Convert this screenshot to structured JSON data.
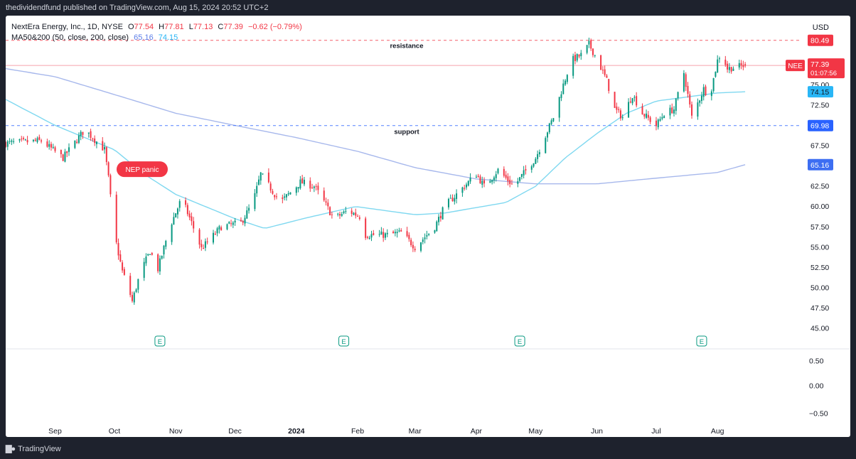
{
  "header": {
    "publisher_line": "thedividendfund published on TradingView.com, Aug 15, 2024 20:52 UTC+2"
  },
  "legend": {
    "symbol_line": "NextEra Energy, Inc., 1D, NYSE",
    "ohlc": {
      "o_label": "O",
      "o": "77.54",
      "h_label": "H",
      "h": "77.81",
      "l_label": "L",
      "l": "77.13",
      "c_label": "C",
      "c": "77.39",
      "change": "−0.62 (−0.79%)"
    },
    "ma_line": "MA50&200 (50, close, 200, close)",
    "ma200_value": "65.16",
    "ma50_value": "74.15"
  },
  "currency": "USD",
  "footer": {
    "brand": "TradingView",
    "logo_icon": "tradingview-logo-icon"
  },
  "colors": {
    "up": "#089981",
    "down": "#f23645",
    "ma50": "#7fd8f0",
    "ma200": "#a7b8ec",
    "support": "#2962ff",
    "resistance": "#f23645"
  },
  "chart_data": {
    "type": "candlestick",
    "symbol": "NEE",
    "price_axis": {
      "min": 43.5,
      "max": 82.8,
      "ticks": [
        "45.00",
        "47.50",
        "50.00",
        "52.50",
        "55.00",
        "57.50",
        "60.00",
        "62.50",
        "65.00",
        "67.50",
        "72.50",
        "75.00"
      ]
    },
    "oscillator_axis": {
      "ticks": [
        "0.50",
        "0.00",
        "−0.50"
      ]
    },
    "time_labels": [
      {
        "label": "Sep",
        "date": "2023-09-01"
      },
      {
        "label": "Oct",
        "date": "2023-10-01"
      },
      {
        "label": "Nov",
        "date": "2023-11-01"
      },
      {
        "label": "Dec",
        "date": "2023-12-01"
      },
      {
        "label": "2024",
        "date": "2024-01-01"
      },
      {
        "label": "Feb",
        "date": "2024-02-01"
      },
      {
        "label": "Mar",
        "date": "2024-03-01"
      },
      {
        "label": "Apr",
        "date": "2024-04-01"
      },
      {
        "label": "May",
        "date": "2024-05-01"
      },
      {
        "label": "Jun",
        "date": "2024-06-01"
      },
      {
        "label": "Jul",
        "date": "2024-07-01"
      },
      {
        "label": "Aug",
        "date": "2024-08-01"
      }
    ],
    "x_range": [
      "2023-08-07",
      "2024-09-12"
    ],
    "last_date": "2024-08-15",
    "price_keyframes": [
      [
        "2023-08-07",
        67.8
      ],
      [
        "2023-08-25",
        68.1
      ],
      [
        "2023-09-05",
        66.0
      ],
      [
        "2023-09-16",
        69.5
      ],
      [
        "2023-09-26",
        67.0
      ],
      [
        "2023-09-28",
        63.5
      ],
      [
        "2023-10-01",
        56.5
      ],
      [
        "2023-10-05",
        52.0
      ],
      [
        "2023-10-08",
        50.0
      ],
      [
        "2023-10-10",
        48.3
      ],
      [
        "2023-10-14",
        51.8
      ],
      [
        "2023-10-19",
        54.5
      ],
      [
        "2023-10-23",
        52.3
      ],
      [
        "2023-10-29",
        57.5
      ],
      [
        "2023-11-04",
        61.0
      ],
      [
        "2023-11-09",
        58.0
      ],
      [
        "2023-11-14",
        54.8
      ],
      [
        "2023-11-24",
        57.5
      ],
      [
        "2023-12-04",
        58.0
      ],
      [
        "2023-12-10",
        60.5
      ],
      [
        "2023-12-14",
        64.0
      ],
      [
        "2023-12-24",
        60.5
      ],
      [
        "2024-01-03",
        63.0
      ],
      [
        "2024-01-10",
        62.5
      ],
      [
        "2024-01-14",
        61.0
      ],
      [
        "2024-01-20",
        58.5
      ],
      [
        "2024-01-27",
        59.5
      ],
      [
        "2024-02-02",
        58.8
      ],
      [
        "2024-02-04",
        56.5
      ],
      [
        "2024-02-16",
        56.5
      ],
      [
        "2024-02-23",
        56.8
      ],
      [
        "2024-03-01",
        55.0
      ],
      [
        "2024-03-11",
        57.5
      ],
      [
        "2024-03-16",
        60.0
      ],
      [
        "2024-03-26",
        62.5
      ],
      [
        "2024-04-01",
        64.0
      ],
      [
        "2024-04-05",
        62.5
      ],
      [
        "2024-04-12",
        64.5
      ],
      [
        "2024-04-20",
        62.5
      ],
      [
        "2024-05-01",
        66.0
      ],
      [
        "2024-05-10",
        71.0
      ],
      [
        "2024-05-15",
        75.0
      ],
      [
        "2024-05-19",
        78.0
      ],
      [
        "2024-05-25",
        78.8
      ],
      [
        "2024-05-28",
        80.0
      ],
      [
        "2024-06-01",
        78.2
      ],
      [
        "2024-06-06",
        75.5
      ],
      [
        "2024-06-10",
        72.0
      ],
      [
        "2024-06-14",
        71.0
      ],
      [
        "2024-06-19",
        73.8
      ],
      [
        "2024-06-24",
        71.5
      ],
      [
        "2024-07-01",
        70.0
      ],
      [
        "2024-07-05",
        71.5
      ],
      [
        "2024-07-10",
        72.0
      ],
      [
        "2024-07-15",
        76.5
      ],
      [
        "2024-07-19",
        71.0
      ],
      [
        "2024-07-25",
        74.5
      ],
      [
        "2024-07-28",
        73.5
      ],
      [
        "2024-08-01",
        78.0
      ],
      [
        "2024-08-03",
        79.0
      ],
      [
        "2024-08-06",
        77.0
      ],
      [
        "2024-08-15",
        77.39
      ]
    ],
    "ma50_keyframes": [
      [
        "2023-08-07",
        73.2
      ],
      [
        "2023-09-01",
        70.0
      ],
      [
        "2023-10-01",
        67.0
      ],
      [
        "2023-10-16",
        64.0
      ],
      [
        "2023-11-01",
        61.5
      ],
      [
        "2023-12-01",
        58.5
      ],
      [
        "2023-12-16",
        57.3
      ],
      [
        "2024-01-06",
        58.6
      ],
      [
        "2024-01-31",
        60.0
      ],
      [
        "2024-03-01",
        59.0
      ],
      [
        "2024-03-16",
        59.2
      ],
      [
        "2024-04-16",
        60.5
      ],
      [
        "2024-05-01",
        62.5
      ],
      [
        "2024-05-16",
        66.0
      ],
      [
        "2024-06-01",
        69.0
      ],
      [
        "2024-06-16",
        71.5
      ],
      [
        "2024-07-01",
        73.0
      ],
      [
        "2024-08-01",
        74.0
      ],
      [
        "2024-08-15",
        74.15
      ]
    ],
    "ma200_keyframes": [
      [
        "2023-08-07",
        77.0
      ],
      [
        "2023-09-01",
        76.0
      ],
      [
        "2023-10-01",
        73.8
      ],
      [
        "2023-11-01",
        71.5
      ],
      [
        "2023-12-01",
        70.0
      ],
      [
        "2024-01-01",
        68.5
      ],
      [
        "2024-02-01",
        66.8
      ],
      [
        "2024-03-01",
        64.8
      ],
      [
        "2024-04-01",
        63.4
      ],
      [
        "2024-05-01",
        62.8
      ],
      [
        "2024-06-01",
        62.8
      ],
      [
        "2024-07-01",
        63.5
      ],
      [
        "2024-08-01",
        64.2
      ],
      [
        "2024-08-15",
        65.16
      ]
    ],
    "levels": [
      {
        "name": "resistance",
        "label": "resistance",
        "value": 80.49,
        "value_label": "80.49",
        "style": "dashed"
      },
      {
        "name": "support",
        "label": "support",
        "value": 69.98,
        "value_label": "69.98",
        "style": "dashed"
      },
      {
        "name": "current",
        "value": 77.39,
        "style": "solid"
      }
    ],
    "price_tags": {
      "resistance": "80.49",
      "support": "69.98",
      "ma50": "74.15",
      "ma200": "65.16",
      "last_symbol": "NEE",
      "last_price": "77.39",
      "countdown": "01:07:56"
    },
    "annotation": {
      "text": "NEP panic",
      "date": "2023-10-10",
      "price": 64.6
    },
    "earnings_markers": [
      {
        "date": "2023-10-24",
        "label": "E"
      },
      {
        "date": "2024-01-25",
        "label": "E"
      },
      {
        "date": "2024-04-23",
        "label": "E"
      },
      {
        "date": "2024-07-24",
        "label": "E"
      }
    ]
  }
}
